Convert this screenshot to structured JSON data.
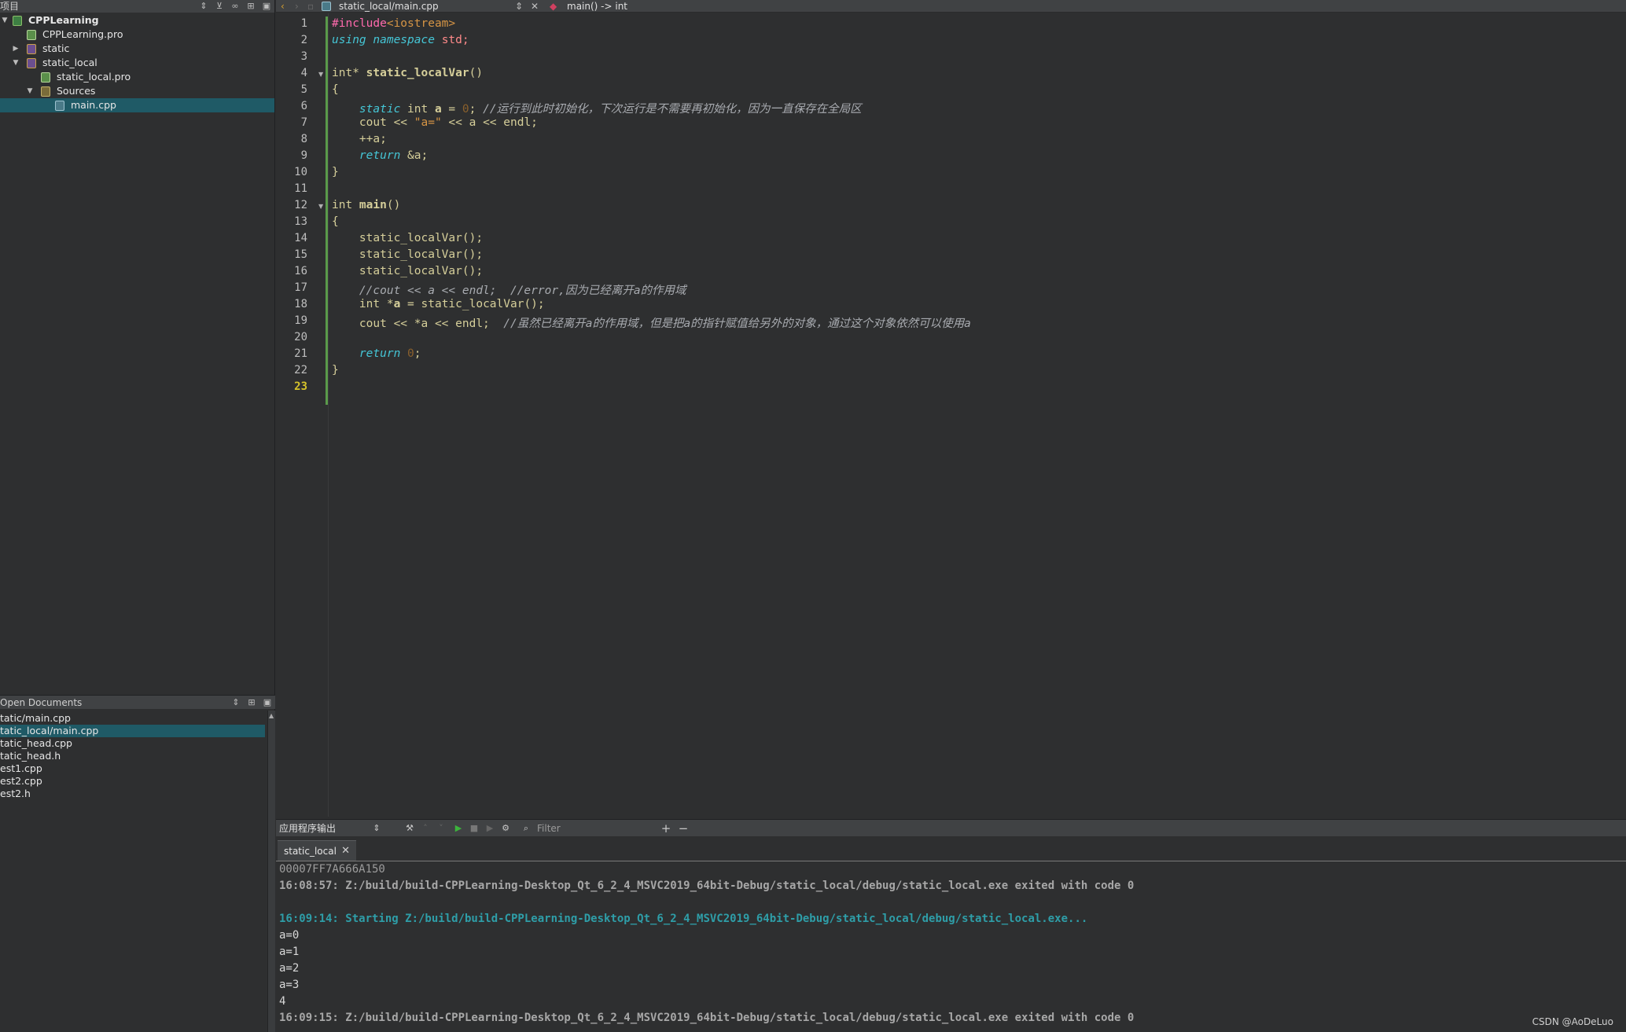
{
  "projects_panel": {
    "title": "项目",
    "tree": [
      {
        "label": "CPPLearning",
        "kind": "project",
        "depth": 0,
        "expanded": true
      },
      {
        "label": "CPPLearning.pro",
        "kind": "pro",
        "depth": 1
      },
      {
        "label": "static",
        "kind": "subproject",
        "depth": 1,
        "expanded": false
      },
      {
        "label": "static_local",
        "kind": "subproject",
        "depth": 1,
        "expanded": true
      },
      {
        "label": "static_local.pro",
        "kind": "pro",
        "depth": 2
      },
      {
        "label": "Sources",
        "kind": "folder",
        "depth": 2,
        "expanded": true
      },
      {
        "label": "main.cpp",
        "kind": "cpp",
        "depth": 3,
        "selected": true
      }
    ]
  },
  "open_documents": {
    "title": "Open Documents",
    "items": [
      {
        "label": "tatic/main.cpp"
      },
      {
        "label": "tatic_local/main.cpp",
        "selected": true
      },
      {
        "label": "tatic_head.cpp"
      },
      {
        "label": "tatic_head.h"
      },
      {
        "label": "est1.cpp"
      },
      {
        "label": "est2.cpp"
      },
      {
        "label": "est2.h"
      }
    ]
  },
  "editor": {
    "file_path": "static_local/main.cpp",
    "symbol": "main() -> int",
    "current_line": "23",
    "line_numbers": [
      "1",
      "2",
      "3",
      "4",
      "5",
      "6",
      "7",
      "8",
      "9",
      "10",
      "11",
      "12",
      "13",
      "14",
      "15",
      "16",
      "17",
      "18",
      "19",
      "20",
      "21",
      "22",
      "23"
    ],
    "code": {
      "l1_a": "#include",
      "l1_b": "<iostream>",
      "l2_a": "using",
      "l2_b": "namespace",
      "l2_c": "std;",
      "l4_a": "int* ",
      "l4_b": "static_localVar",
      "l4_c": "()",
      "l5": "{",
      "l6_a": "static",
      "l6_b": " int ",
      "l6_c": "a",
      "l6_d": " = ",
      "l6_e": "0",
      "l6_f": "; ",
      "l6_g": "//运行到此时初始化，下次运行是不需要再初始化，因为一直保存在全局区",
      "l7_a": "cout << ",
      "l7_b": "\"a=\"",
      "l7_c": " << a << endl;",
      "l8": "++a;",
      "l9_a": "return",
      "l9_b": " &a;",
      "l10": "}",
      "l12_a": "int ",
      "l12_b": "main",
      "l12_c": "()",
      "l13": "{",
      "l14": "static_localVar();",
      "l15": "static_localVar();",
      "l16": "static_localVar();",
      "l17": "//cout << a << endl;  //error,因为已经离开a的作用域",
      "l18_a": "int *",
      "l18_b": "a",
      "l18_c": " = static_localVar();",
      "l19_a": "cout << *a << endl;  ",
      "l19_b": "//虽然已经离开a的作用域，但是把a的指针赋值给另外的对象，通过这个对象依然可以使用a",
      "l21_a": "return",
      "l21_b": " 0",
      "l21_c": ";",
      "l22": "}"
    }
  },
  "output_pane": {
    "title": "应用程序输出",
    "filter_placeholder": "Filter",
    "tab_label": "static_local",
    "lines": [
      "00007FF7A666A150",
      "16:08:57: Z:/build/build-CPPLearning-Desktop_Qt_6_2_4_MSVC2019_64bit-Debug/static_local/debug/static_local.exe exited with code 0",
      "16:09:14: Starting Z:/build/build-CPPLearning-Desktop_Qt_6_2_4_MSVC2019_64bit-Debug/static_local/debug/static_local.exe...",
      "a=0",
      "a=1",
      "a=2",
      "a=3",
      "4",
      "16:09:15: Z:/build/build-CPPLearning-Desktop_Qt_6_2_4_MSVC2019_64bit-Debug/static_local/debug/static_local.exe exited with code 0"
    ]
  },
  "watermark": "CSDN @AoDeLuo",
  "colors": {
    "background": "#2e2f30",
    "panel_header": "#404244",
    "selection": "#1f5a66",
    "keyword": "#45c6d6",
    "string": "#d69545",
    "comment": "#a8abb0",
    "preprocessor": "#ff6aad",
    "output_highlight": "#2e9ea8"
  }
}
